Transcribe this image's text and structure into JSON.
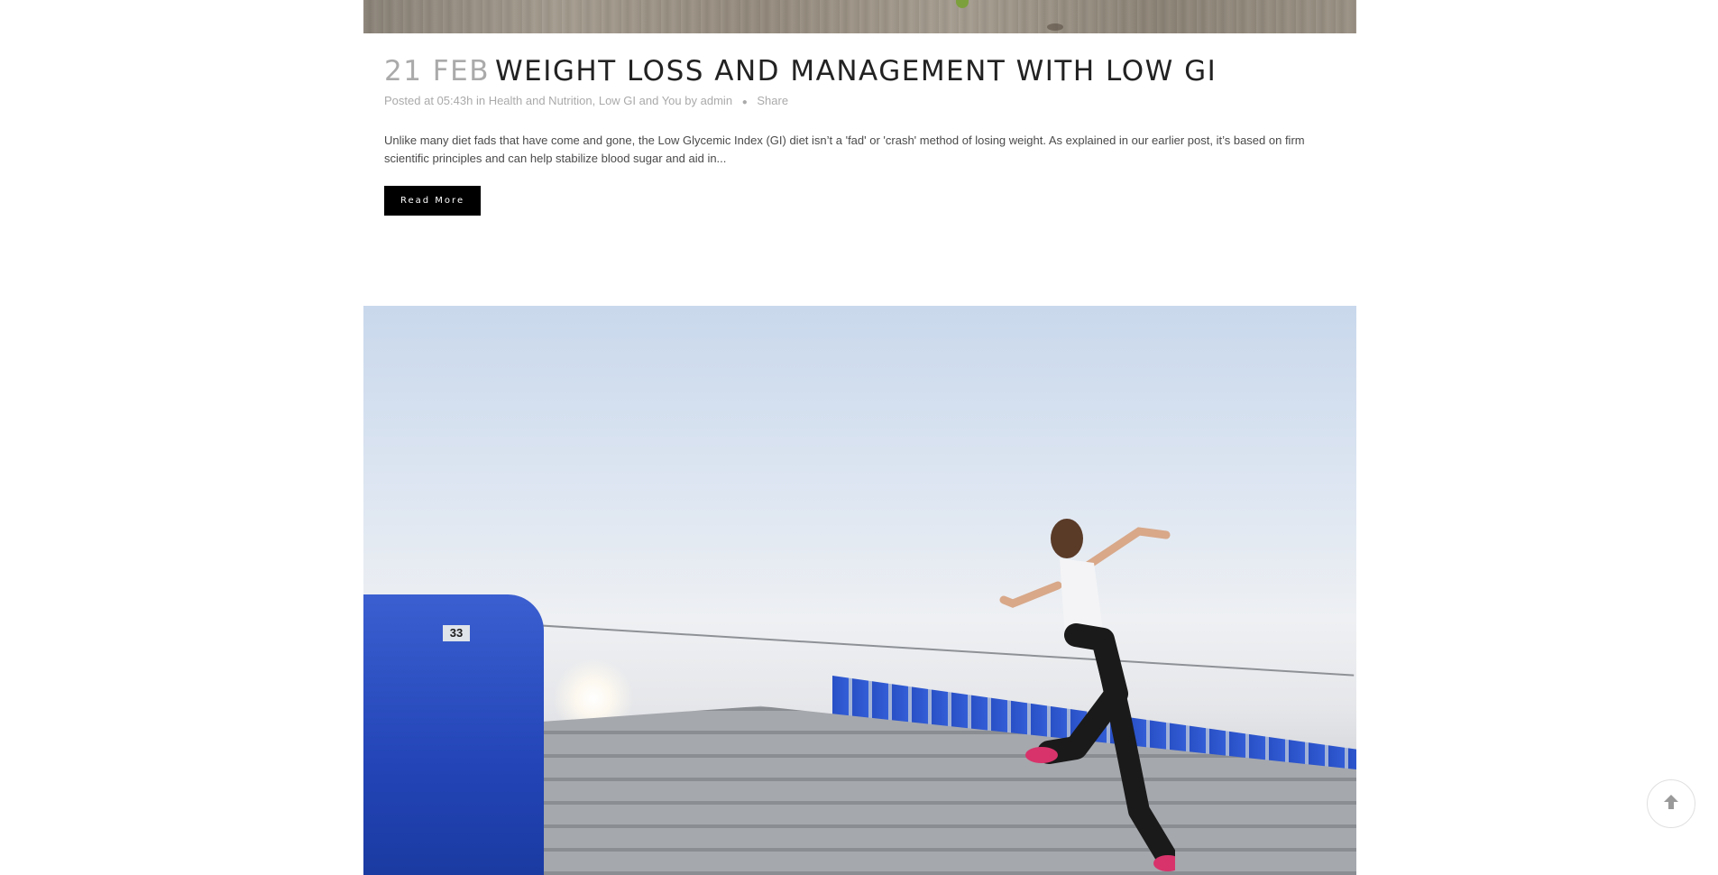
{
  "post": {
    "date": "21 FEB",
    "title": "WEIGHT LOSS AND MANAGEMENT WITH LOW GI",
    "meta": {
      "posted_at": "Posted at 05:43h",
      "in_label": "in",
      "category_1": "Health and Nutrition",
      "separator": ",",
      "category_2": "Low GI and You",
      "by_label": "by",
      "author": "admin",
      "share": "Share"
    },
    "excerpt": "Unlike many diet fads that have come and gone, the Low Glycemic Index (GI) diet isn’t a 'fad' or 'crash' method of losing weight. As explained in our earlier post, it’s based on firm scientific principles and can help stabilize blood sugar and aid in...",
    "read_more": "Read More"
  },
  "next_post_image": {
    "seat_number": "33"
  },
  "icons": {
    "scroll_top": "arrow-up-circle-icon"
  }
}
